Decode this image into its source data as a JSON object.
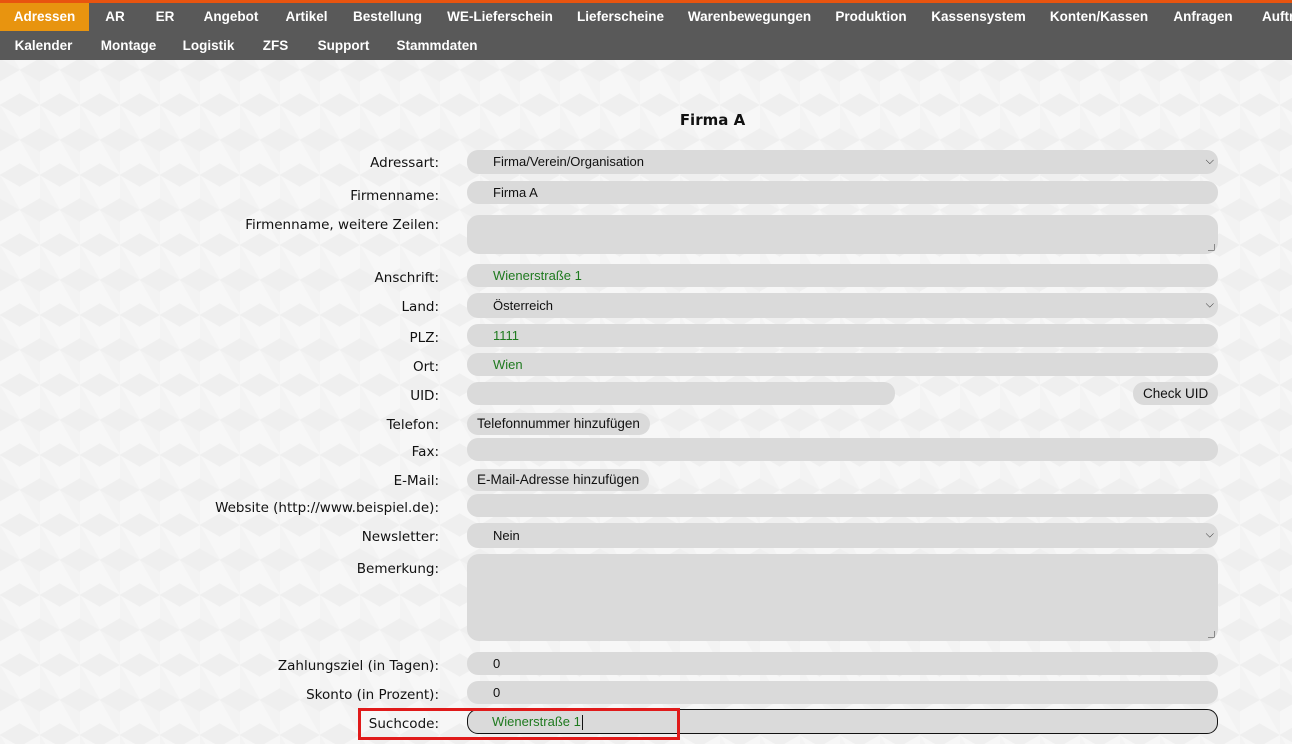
{
  "nav": {
    "row1": [
      {
        "label": "Adressen",
        "active": true
      },
      {
        "label": "AR"
      },
      {
        "label": "ER"
      },
      {
        "label": "Angebot"
      },
      {
        "label": "Artikel"
      },
      {
        "label": "Bestellung"
      },
      {
        "label": "WE-Lieferschein"
      },
      {
        "label": "Lieferscheine"
      },
      {
        "label": "Warenbewegungen"
      },
      {
        "label": "Produktion"
      },
      {
        "label": "Kassensystem"
      },
      {
        "label": "Konten/Kassen"
      },
      {
        "label": "Anfragen"
      },
      {
        "label": "Auftr"
      }
    ],
    "row2": [
      {
        "label": "Kalender"
      },
      {
        "label": "Montage"
      },
      {
        "label": "Logistik"
      },
      {
        "label": "ZFS"
      },
      {
        "label": "Support"
      },
      {
        "label": "Stammdaten"
      }
    ],
    "accent_color": "#e8940f",
    "bar_color": "#595959",
    "top_border_color": "#e8540f"
  },
  "form": {
    "title": "Firma A",
    "adressart": {
      "label": "Adressart:",
      "value": "Firma/Verein/Organisation"
    },
    "firmenname": {
      "label": "Firmenname:",
      "value": "Firma A"
    },
    "firmenname_weitere": {
      "label": "Firmenname, weitere Zeilen:",
      "value": ""
    },
    "anschrift": {
      "label": "Anschrift:",
      "value": "Wienerstraße 1"
    },
    "land": {
      "label": "Land:",
      "value": "Österreich"
    },
    "plz": {
      "label": "PLZ:",
      "value": "1111"
    },
    "ort": {
      "label": "Ort:",
      "value": "Wien"
    },
    "uid": {
      "label": "UID:",
      "value": "",
      "button": "Check UID"
    },
    "telefon": {
      "label": "Telefon:",
      "button": "Telefonnummer hinzufügen"
    },
    "fax": {
      "label": "Fax:",
      "value": ""
    },
    "email": {
      "label": "E-Mail:",
      "button": "E-Mail-Adresse hinzufügen"
    },
    "website": {
      "label": "Website (http://www.beispiel.de):",
      "value": ""
    },
    "newsletter": {
      "label": "Newsletter:",
      "value": "Nein"
    },
    "bemerkung": {
      "label": "Bemerkung:",
      "value": ""
    },
    "zahlungsziel": {
      "label": "Zahlungsziel (in Tagen):",
      "value": "0"
    },
    "skonto": {
      "label": "Skonto (in Prozent):",
      "value": "0"
    },
    "suchcode": {
      "label": "Suchcode:",
      "value": "Wienerstraße 1"
    },
    "highlight_color": "#e01a1a",
    "value_green": "#1f7a1f"
  }
}
